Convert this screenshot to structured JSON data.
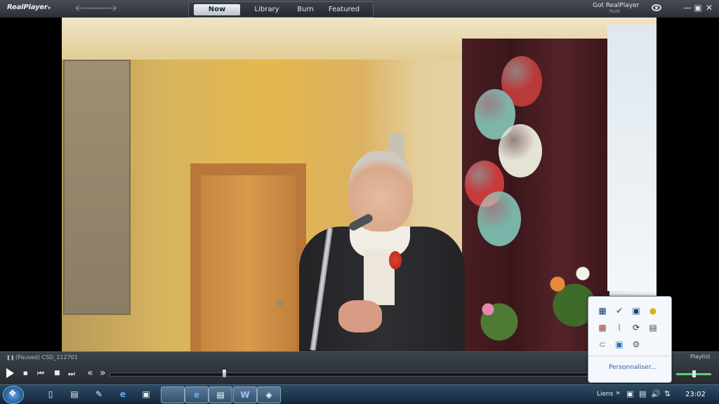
{
  "player": {
    "logo": "RealPlayer",
    "logo_caret": "▾",
    "back_arrow": "🡐",
    "forward_arrow": "🡒",
    "tabs": [
      {
        "label": "Now Playing",
        "active": true
      },
      {
        "label": "Library",
        "active": false
      },
      {
        "label": "Burn",
        "active": false
      },
      {
        "label": "Featured",
        "active": false
      }
    ],
    "get_realplayer": "Got RealPlayer",
    "get_realplayer_sub": "PLUS",
    "window_buttons": {
      "minimize": "—",
      "restore": "▣",
      "close": "✕"
    }
  },
  "video": {
    "balloon_colors": [
      "#b83a3a",
      "#7fb4a8",
      "#e5e3d4",
      "#c73b3b",
      "#7ab3a7"
    ]
  },
  "controls": {
    "status": "(Paused) CSD_112701",
    "pause_indicator": "❚❚",
    "stop": "■",
    "prev": "⏮",
    "stop2": "■",
    "next": "⏭",
    "rewind": "«",
    "fastforward": "»",
    "playlist": "Playlist",
    "seek_fraction": 0.24,
    "volume_fraction": 0.5
  },
  "taskbar": {
    "icons": [
      "▯",
      "▤",
      "✎",
      "e",
      "▣",
      "e",
      "▤",
      "W",
      "◈"
    ],
    "liens": "Liens",
    "tray_arrow": "»",
    "tray_icons": [
      "▣",
      "▤",
      "🔊",
      "⇅"
    ],
    "clock": "23:02"
  },
  "tray_popup": {
    "icons": [
      "▦",
      "✔",
      "▣",
      "●",
      "▩",
      "⌇",
      "⟳",
      "▤",
      "⊂",
      "▣",
      "⚙"
    ],
    "icon_colors": [
      "#1f3b6b",
      "#3d9d3c",
      "#1f3b6b",
      "#d9b21a",
      "#9b3a3a",
      "#3d9d3c",
      "#222222",
      "#444444",
      "#3d9d3c",
      "#2b6ab0",
      "#555555"
    ],
    "customize": "Personnaliser..."
  }
}
